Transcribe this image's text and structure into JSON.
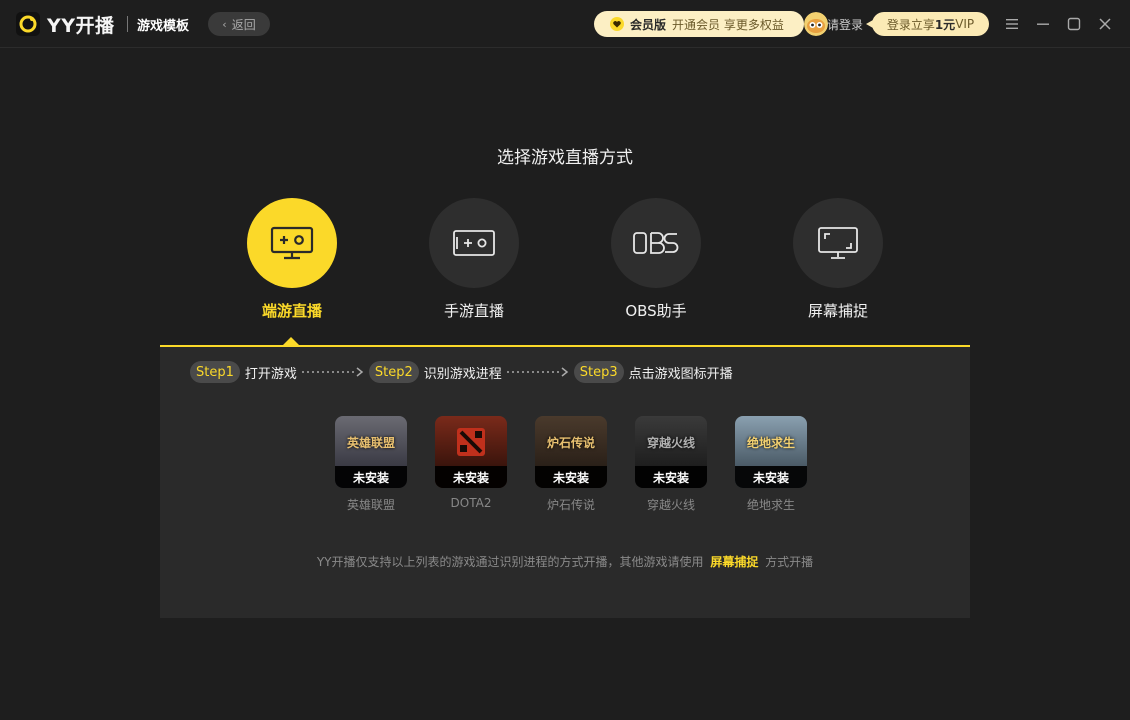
{
  "header": {
    "brand": "YY开播",
    "section_title": "游戏模板",
    "back_label": "返回",
    "vip": {
      "title": "会员版",
      "desc": "开通会员 享更多权益"
    },
    "login_text": "请登录",
    "promo": {
      "prefix": "登录立享",
      "highlight": "1元",
      "suffix": "VIP"
    }
  },
  "main": {
    "title": "选择游戏直播方式",
    "modes": [
      {
        "label": "端游直播",
        "icon": "pc-game-icon",
        "active": true
      },
      {
        "label": "手游直播",
        "icon": "mobile-game-icon",
        "active": false
      },
      {
        "label": "OBS助手",
        "icon": "obs-icon",
        "active": false
      },
      {
        "label": "屏幕捕捉",
        "icon": "screen-capture-icon",
        "active": false
      }
    ],
    "steps": [
      {
        "badge": "Step1",
        "text": "打开游戏"
      },
      {
        "badge": "Step2",
        "text": "识别游戏进程"
      },
      {
        "badge": "Step3",
        "text": "点击游戏图标开播"
      }
    ],
    "games": [
      {
        "name": "英雄联盟",
        "status": "未安装",
        "art": "英雄联盟",
        "color": "#4a4a52"
      },
      {
        "name": "DOTA2",
        "status": "未安装",
        "art": "",
        "color": "#5a2418"
      },
      {
        "name": "炉石传说",
        "status": "未安装",
        "art": "炉石传说",
        "color": "#3a2e24"
      },
      {
        "name": "穿越火线",
        "status": "未安装",
        "art": "穿越火线",
        "color": "#2c2c2c"
      },
      {
        "name": "绝地求生",
        "status": "未安装",
        "art": "绝地求生",
        "color": "#5a6a78"
      }
    ],
    "note": {
      "prefix": "YY开播仅支持以上列表的游戏通过识别进程的方式开播，其他游戏请使用",
      "highlight": "屏幕捕捉",
      "suffix": "方式开播"
    },
    "accent_color": "#fbd929"
  }
}
